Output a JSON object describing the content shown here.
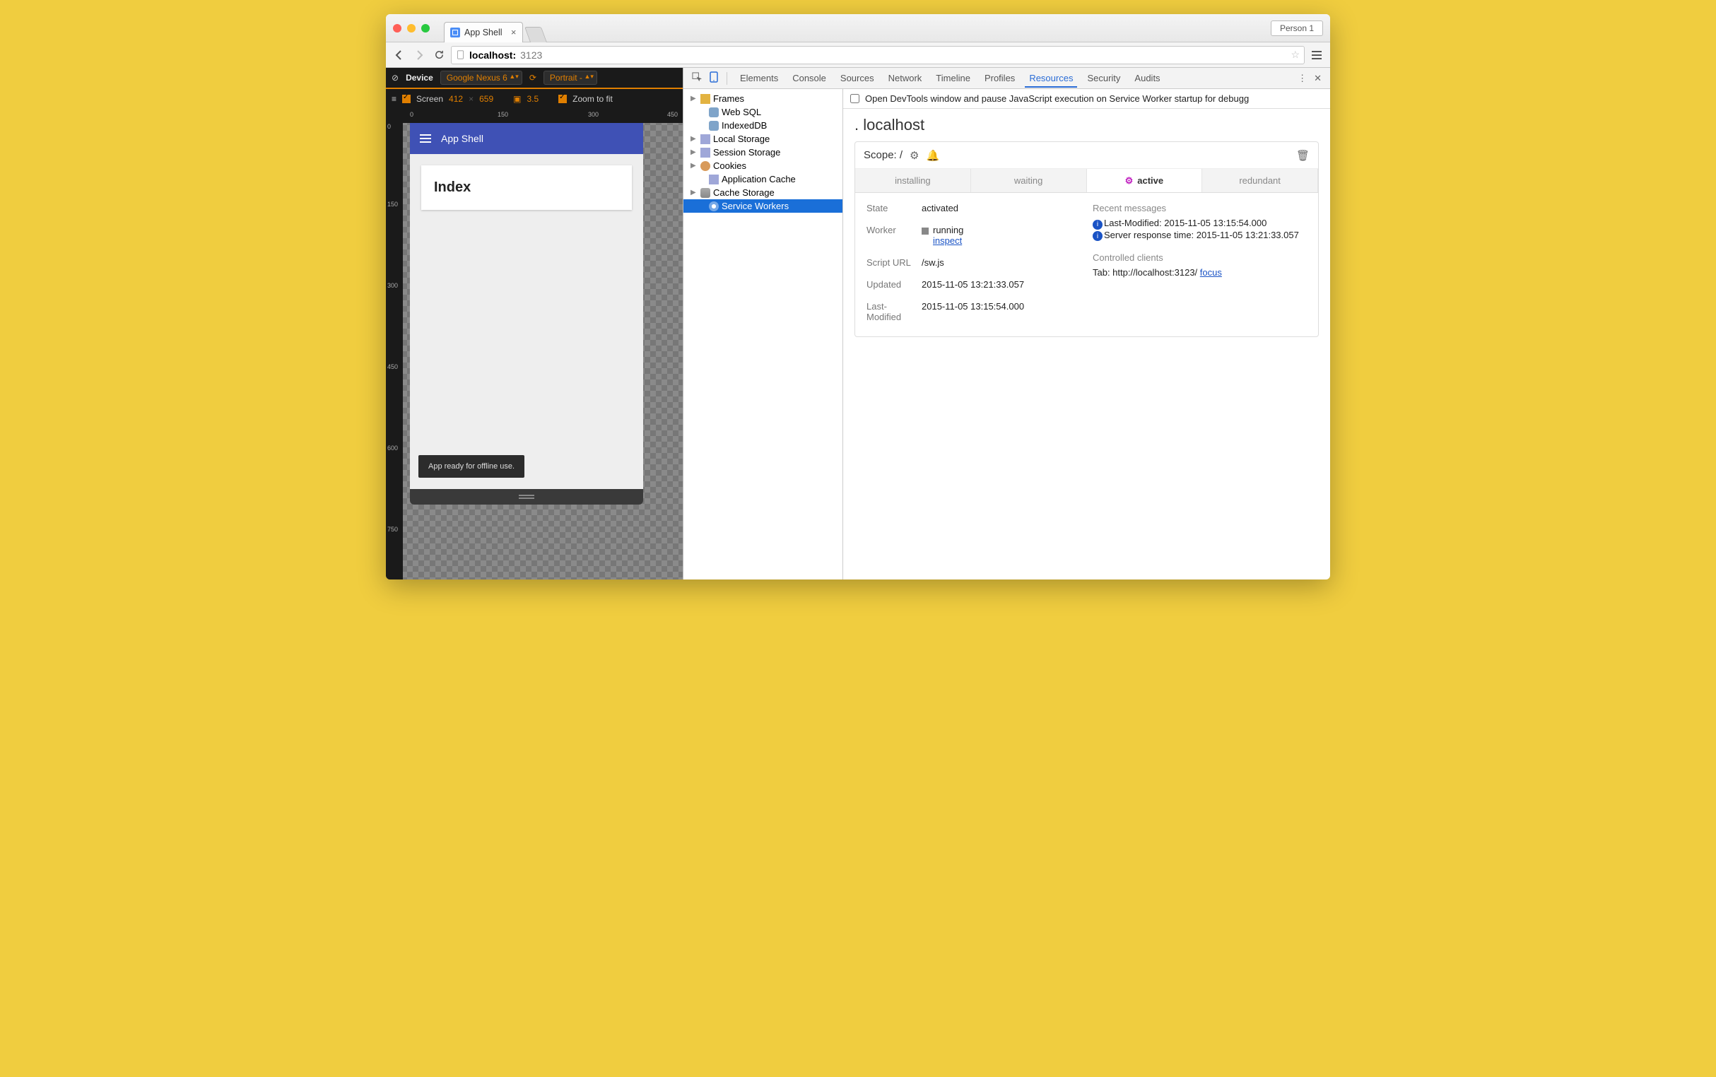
{
  "browser": {
    "tab_title": "App Shell",
    "profile": "Person 1",
    "url_host": "localhost:",
    "url_port": "3123"
  },
  "device_toolbar": {
    "device_label": "Device",
    "device_value": "Google Nexus 6",
    "orientation": "Portrait ‑",
    "screen_label": "Screen",
    "width": "412",
    "height": "659",
    "dpr": "3.5",
    "zoom_label": "Zoom to fit",
    "ruler_h": [
      "0",
      "150",
      "300",
      "450"
    ],
    "ruler_v": [
      "0",
      "150",
      "300",
      "450",
      "600",
      "750"
    ]
  },
  "app_preview": {
    "appbar_title": "App Shell",
    "card_title": "Index",
    "toast": "App ready for offline use."
  },
  "devtools": {
    "tabs": [
      "Elements",
      "Console",
      "Sources",
      "Network",
      "Timeline",
      "Profiles",
      "Resources",
      "Security",
      "Audits"
    ],
    "active_tab": "Resources",
    "option_text": "Open DevTools window and pause JavaScript execution on Service Worker startup for debugg",
    "tree": [
      {
        "label": "Frames",
        "icon": "folder",
        "arrow": true
      },
      {
        "label": "Web SQL",
        "icon": "db",
        "arrow": false,
        "indent": true
      },
      {
        "label": "IndexedDB",
        "icon": "db",
        "arrow": false,
        "indent": true
      },
      {
        "label": "Local Storage",
        "icon": "grid",
        "arrow": true
      },
      {
        "label": "Session Storage",
        "icon": "grid",
        "arrow": true
      },
      {
        "label": "Cookies",
        "icon": "cookie",
        "arrow": true
      },
      {
        "label": "Application Cache",
        "icon": "grid",
        "arrow": false,
        "indent": true
      },
      {
        "label": "Cache Storage",
        "icon": "cache",
        "arrow": true
      },
      {
        "label": "Service Workers",
        "icon": "gear",
        "arrow": false,
        "indent": true,
        "selected": true
      }
    ],
    "sw": {
      "origin": "localhost",
      "scope_label": "Scope: ",
      "scope_value": "/",
      "tabs": [
        "installing",
        "waiting",
        "active",
        "redundant"
      ],
      "active_tab": "active",
      "state_label": "State",
      "state_value": "activated",
      "worker_label": "Worker",
      "worker_status": "running",
      "worker_inspect": "inspect",
      "script_label": "Script URL",
      "script_value": "/sw.js",
      "updated_label": "Updated",
      "updated_value": "2015-11-05 13:21:33.057",
      "lastmod_label": "Last-Modified",
      "lastmod_value": "2015-11-05 13:15:54.000",
      "recent_title": "Recent messages",
      "recent_msgs": [
        "Last-Modified: 2015-11-05 13:15:54.000",
        "Server response time: 2015-11-05 13:21:33.057"
      ],
      "clients_title": "Controlled clients",
      "client_prefix": "Tab: http://localhost:3123/ ",
      "client_link": "focus"
    }
  }
}
